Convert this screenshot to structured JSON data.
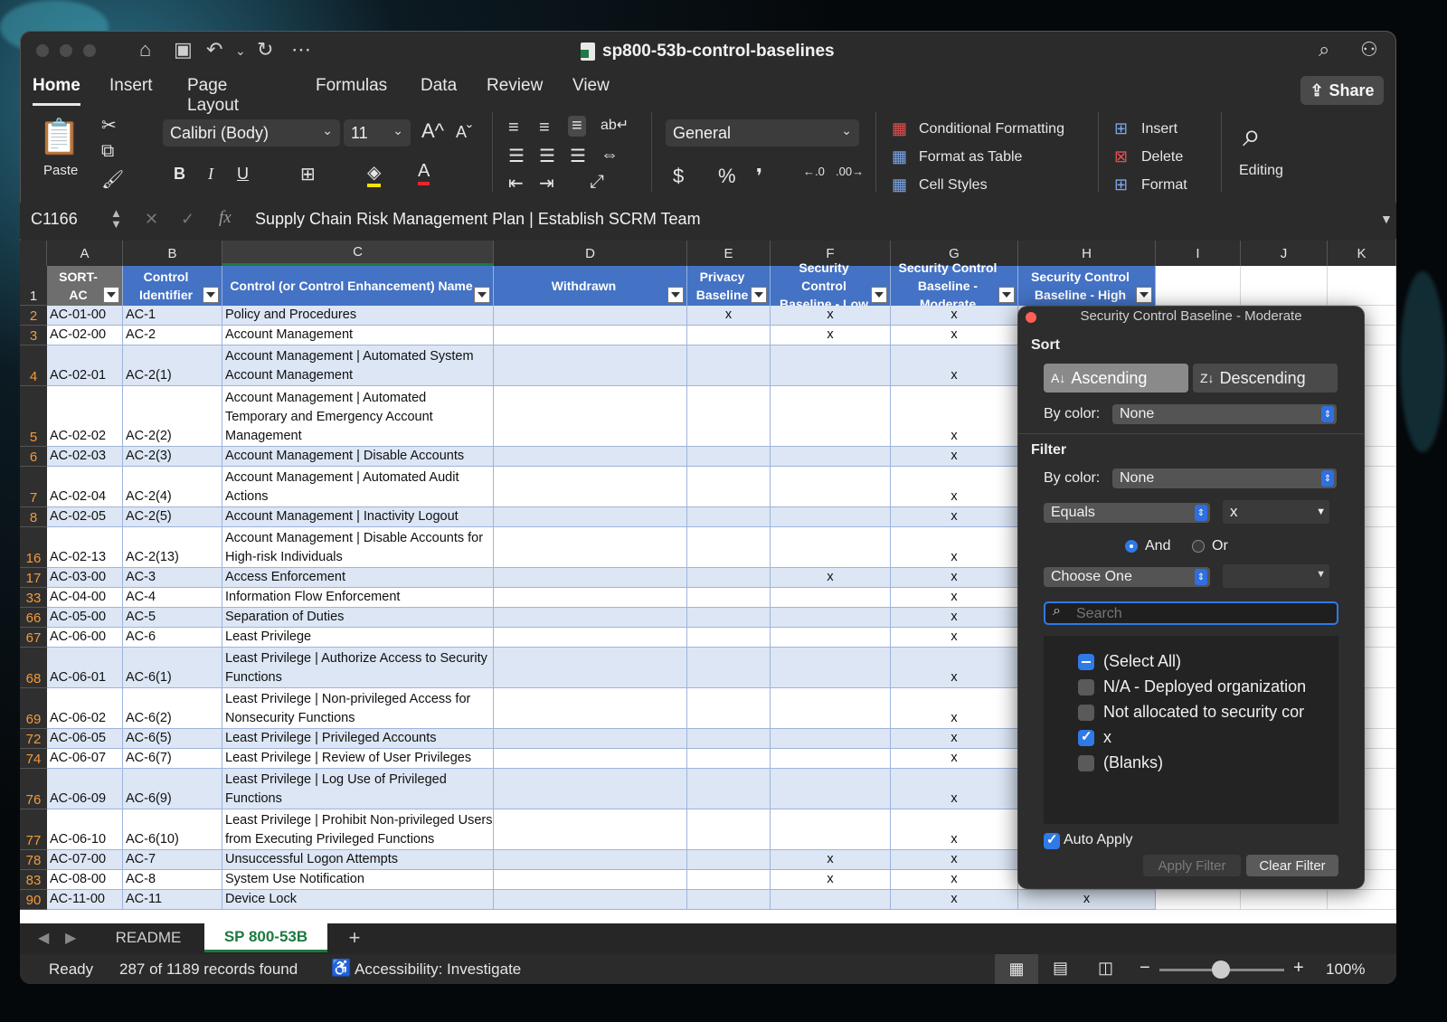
{
  "window": {
    "title": "sp800-53b-control-baselines"
  },
  "tabs": [
    {
      "label": "Home"
    },
    {
      "label": "Insert"
    },
    {
      "label": "Page Layout"
    },
    {
      "label": "Formulas"
    },
    {
      "label": "Data"
    },
    {
      "label": "Review"
    },
    {
      "label": "View"
    }
  ],
  "share_label": "Share",
  "ribbon": {
    "paste": "Paste",
    "font_name": "Calibri (Body)",
    "font_size": "11",
    "bold": "B",
    "italic": "I",
    "underline": "U",
    "number_format": "General",
    "currency": "$",
    "percent": "%",
    "comma": "❜",
    "cond_formatting": "Conditional Formatting",
    "format_as_table": "Format as Table",
    "cell_styles": "Cell Styles",
    "insert": "Insert",
    "delete": "Delete",
    "format": "Format",
    "editing": "Editing"
  },
  "formula_bar": {
    "name_box": "C1166",
    "fx": "fx",
    "content": "Supply Chain Risk Management Plan | Establish SCRM Team"
  },
  "columns": [
    "A",
    "B",
    "C",
    "D",
    "E",
    "F",
    "G",
    "H",
    "I",
    "J",
    "K"
  ],
  "table_headers": {
    "a": "SORT-AC",
    "b": "Control Identifier",
    "c": "Control (or Control Enhancement) Name",
    "d": "Withdrawn",
    "e": "Privacy Baseline",
    "f": "Security Control Baseline - Low",
    "g": "Security Control Baseline - Moderate",
    "h": "Security Control Baseline - High"
  },
  "rows": [
    {
      "num": "2",
      "a": "AC-01-00",
      "b": "AC-1",
      "c1": "Policy and Procedures",
      "c2": "",
      "c3": "",
      "e": "x",
      "f": "x",
      "g": "x",
      "h": ""
    },
    {
      "num": "3",
      "a": "AC-02-00",
      "b": "AC-2",
      "c1": "Account Management",
      "c2": "",
      "c3": "",
      "e": "",
      "f": "x",
      "g": "x",
      "h": ""
    },
    {
      "num": "4",
      "a": "AC-02-01",
      "b": "AC-2(1)",
      "c1": "Account Management | Automated System",
      "c2": "Account Management",
      "c3": "",
      "e": "",
      "f": "",
      "g": "x",
      "h": ""
    },
    {
      "num": "5",
      "a": "AC-02-02",
      "b": "AC-2(2)",
      "c1": "Account Management | Automated",
      "c2": "Temporary and Emergency Account",
      "c3": "Management",
      "e": "",
      "f": "",
      "g": "x",
      "h": ""
    },
    {
      "num": "6",
      "a": "AC-02-03",
      "b": "AC-2(3)",
      "c1": "Account Management | Disable Accounts",
      "c2": "",
      "c3": "",
      "e": "",
      "f": "",
      "g": "x",
      "h": ""
    },
    {
      "num": "7",
      "a": "AC-02-04",
      "b": "AC-2(4)",
      "c1": "Account Management | Automated Audit",
      "c2": "Actions",
      "c3": "",
      "e": "",
      "f": "",
      "g": "x",
      "h": ""
    },
    {
      "num": "8",
      "a": "AC-02-05",
      "b": "AC-2(5)",
      "c1": "Account Management | Inactivity Logout",
      "c2": "",
      "c3": "",
      "e": "",
      "f": "",
      "g": "x",
      "h": ""
    },
    {
      "num": "16",
      "a": "AC-02-13",
      "b": "AC-2(13)",
      "c1": "Account Management | Disable Accounts for",
      "c2": "High-risk Individuals",
      "c3": "",
      "e": "",
      "f": "",
      "g": "x",
      "h": ""
    },
    {
      "num": "17",
      "a": "AC-03-00",
      "b": "AC-3",
      "c1": "Access Enforcement",
      "c2": "",
      "c3": "",
      "e": "",
      "f": "x",
      "g": "x",
      "h": ""
    },
    {
      "num": "33",
      "a": "AC-04-00",
      "b": "AC-4",
      "c1": "Information Flow Enforcement",
      "c2": "",
      "c3": "",
      "e": "",
      "f": "",
      "g": "x",
      "h": ""
    },
    {
      "num": "66",
      "a": "AC-05-00",
      "b": "AC-5",
      "c1": "Separation of Duties",
      "c2": "",
      "c3": "",
      "e": "",
      "f": "",
      "g": "x",
      "h": ""
    },
    {
      "num": "67",
      "a": "AC-06-00",
      "b": "AC-6",
      "c1": "Least Privilege",
      "c2": "",
      "c3": "",
      "e": "",
      "f": "",
      "g": "x",
      "h": ""
    },
    {
      "num": "68",
      "a": "AC-06-01",
      "b": "AC-6(1)",
      "c1": "Least Privilege | Authorize Access to Security",
      "c2": "Functions",
      "c3": "",
      "e": "",
      "f": "",
      "g": "x",
      "h": ""
    },
    {
      "num": "69",
      "a": "AC-06-02",
      "b": "AC-6(2)",
      "c1": "Least Privilege | Non-privileged Access for",
      "c2": "Nonsecurity Functions",
      "c3": "",
      "e": "",
      "f": "",
      "g": "x",
      "h": ""
    },
    {
      "num": "72",
      "a": "AC-06-05",
      "b": "AC-6(5)",
      "c1": "Least Privilege | Privileged Accounts",
      "c2": "",
      "c3": "",
      "e": "",
      "f": "",
      "g": "x",
      "h": ""
    },
    {
      "num": "74",
      "a": "AC-06-07",
      "b": "AC-6(7)",
      "c1": "Least Privilege | Review of User Privileges",
      "c2": "",
      "c3": "",
      "e": "",
      "f": "",
      "g": "x",
      "h": ""
    },
    {
      "num": "76",
      "a": "AC-06-09",
      "b": "AC-6(9)",
      "c1": "Least Privilege | Log Use of Privileged",
      "c2": "Functions",
      "c3": "",
      "e": "",
      "f": "",
      "g": "x",
      "h": ""
    },
    {
      "num": "77",
      "a": "AC-06-10",
      "b": "AC-6(10)",
      "c1": "Least Privilege | Prohibit Non-privileged Users",
      "c2": "from Executing Privileged Functions",
      "c3": "",
      "e": "",
      "f": "",
      "g": "x",
      "h": ""
    },
    {
      "num": "78",
      "a": "AC-07-00",
      "b": "AC-7",
      "c1": "Unsuccessful Logon Attempts",
      "c2": "",
      "c3": "",
      "e": "",
      "f": "x",
      "g": "x",
      "h": ""
    },
    {
      "num": "83",
      "a": "AC-08-00",
      "b": "AC-8",
      "c1": "System Use Notification",
      "c2": "",
      "c3": "",
      "e": "",
      "f": "x",
      "g": "x",
      "h": ""
    },
    {
      "num": "90",
      "a": "AC-11-00",
      "b": "AC-11",
      "c1": "Device Lock",
      "c2": "",
      "c3": "",
      "e": "",
      "f": "",
      "g": "x",
      "h": "x"
    }
  ],
  "sheet_tabs": [
    {
      "label": "README"
    },
    {
      "label": "SP 800-53B"
    },
    {
      "label": "+"
    }
  ],
  "status": {
    "ready": "Ready",
    "records": "287 of 1189 records found",
    "accessibility": "Accessibility: Investigate",
    "zoom": "100%"
  },
  "filter_panel": {
    "title": "Security Control Baseline - Moderate",
    "sort_heading": "Sort",
    "ascending": "Ascending",
    "descending": "Descending",
    "by_color_label": "By color:",
    "sort_by_color": "None",
    "filter_heading": "Filter",
    "filter_by_color": "None",
    "condition1": "Equals",
    "condition1_value": "x",
    "and_label": "And",
    "or_label": "Or",
    "condition2": "Choose One",
    "search_placeholder": "Search",
    "values": [
      {
        "label": "(Select All)",
        "state": "mixed"
      },
      {
        "label": "N/A - Deployed organization",
        "state": "off"
      },
      {
        "label": "Not allocated to security cor",
        "state": "off"
      },
      {
        "label": "x",
        "state": "on"
      },
      {
        "label": "(Blanks)",
        "state": "off"
      }
    ],
    "auto_apply": "Auto Apply",
    "apply_filter": "Apply Filter",
    "clear_filter": "Clear Filter"
  }
}
